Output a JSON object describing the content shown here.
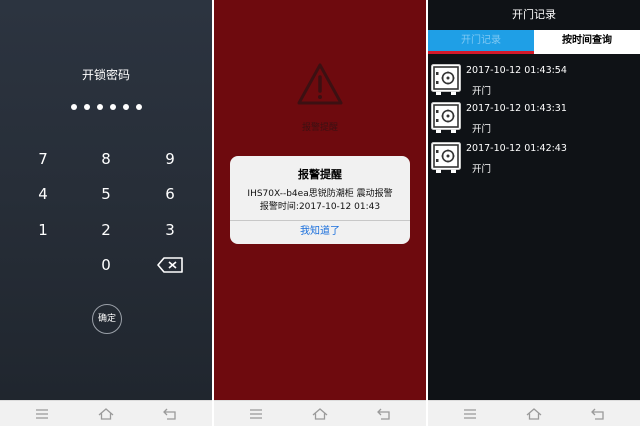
{
  "lock_screen": {
    "title": "开锁密码",
    "keys": [
      "7",
      "8",
      "9",
      "4",
      "5",
      "6",
      "1",
      "2",
      "3",
      "0"
    ],
    "confirm_label": "确定",
    "password_dot_count": 6
  },
  "alarm_screen": {
    "background_caption": "报警提醒",
    "dialog": {
      "title": "报警提醒",
      "line1": "IHS70X--b4ea思锐防潮柜  震动报警",
      "line2": "报警时间:2017-10-12 01:43",
      "button": "我知道了"
    }
  },
  "records_screen": {
    "title": "开门记录",
    "tabs": [
      "开门记录",
      "按时间查询"
    ],
    "records": [
      {
        "time": "2017-10-12 01:43:54",
        "action": "开门"
      },
      {
        "time": "2017-10-12 01:43:31",
        "action": "开门"
      },
      {
        "time": "2017-10-12 01:42:43",
        "action": "开门"
      }
    ]
  },
  "icons": {
    "nav": [
      "menu-icon",
      "home-icon",
      "back-icon"
    ],
    "warning": "warning-triangle-icon",
    "record": "safe-icon",
    "backspace": "backspace-icon"
  },
  "colors": {
    "alarm_bg": "#6e0a0e",
    "tab_active": "#1f9fe6",
    "tab_indicator": "#d4182a",
    "dialog_button": "#1a6fdc"
  }
}
